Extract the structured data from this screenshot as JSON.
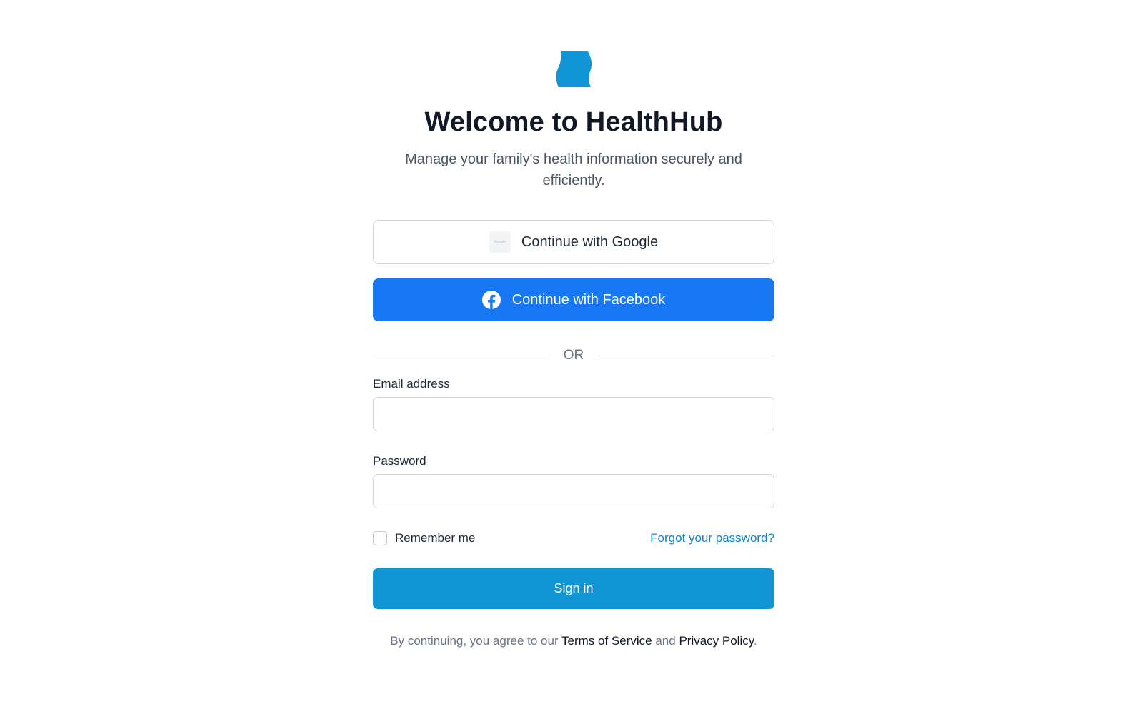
{
  "brand": {
    "logo_icon": "healthhub-logo-icon",
    "logo_color": "#1195d6"
  },
  "header": {
    "title": "Welcome to HealthHub",
    "subtitle": "Manage your family's health information securely and efficiently."
  },
  "social": {
    "google_label": "Continue with Google",
    "google_icon": "google-icon",
    "google_icon_text": "Google",
    "facebook_label": "Continue with Facebook",
    "facebook_icon": "facebook-icon",
    "facebook_color": "#1877f2"
  },
  "divider": {
    "text": "OR"
  },
  "form": {
    "email_label": "Email address",
    "email_value": "",
    "email_placeholder": "",
    "password_label": "Password",
    "password_value": "",
    "password_placeholder": "",
    "remember_label": "Remember me",
    "remember_checked": false,
    "forgot_label": "Forgot your password?",
    "submit_label": "Sign in",
    "accent_color": "#1295d4"
  },
  "footer": {
    "prefix": "By continuing, you agree to our ",
    "terms_label": "Terms of Service",
    "and": " and ",
    "privacy_label": "Privacy Policy",
    "suffix": "."
  }
}
